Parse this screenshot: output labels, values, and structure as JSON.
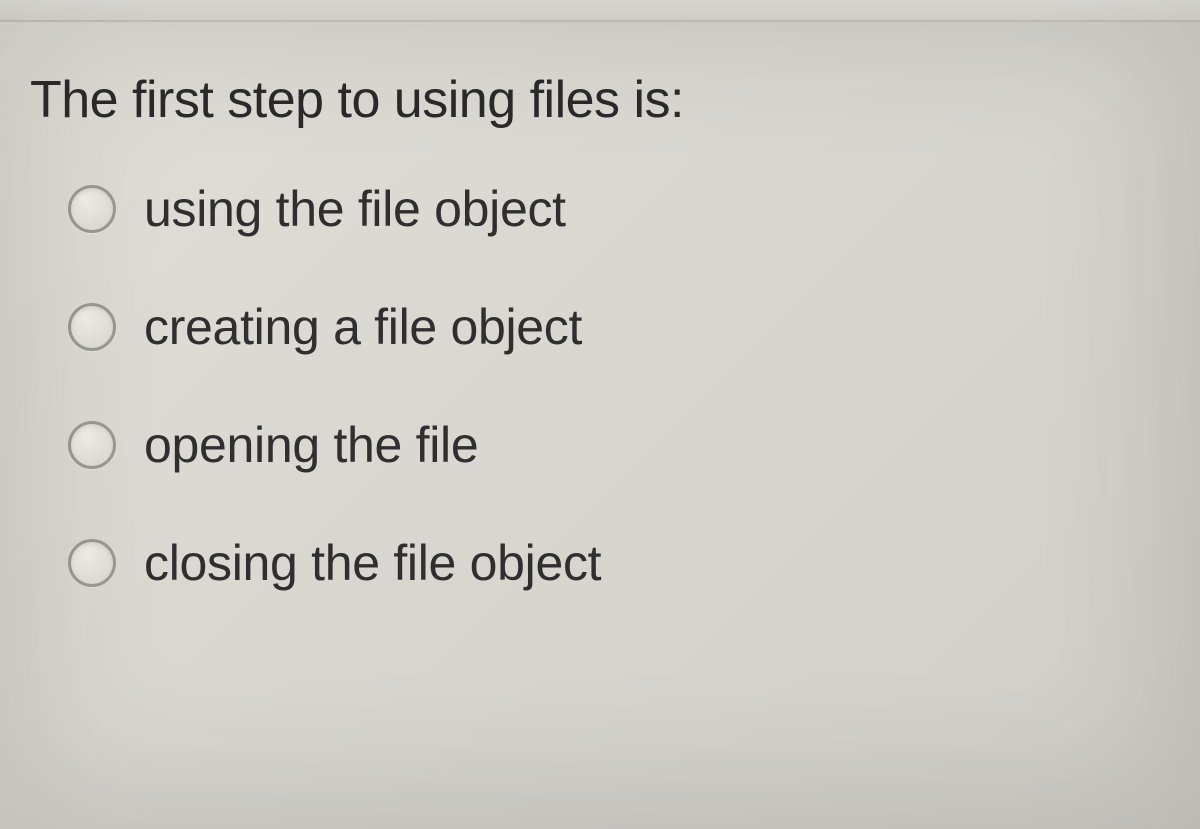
{
  "question": {
    "text": "The first step to using files is:",
    "options": [
      {
        "label": "using the file object"
      },
      {
        "label": "creating a file object"
      },
      {
        "label": "opening the file"
      },
      {
        "label": "closing the file object"
      }
    ]
  }
}
